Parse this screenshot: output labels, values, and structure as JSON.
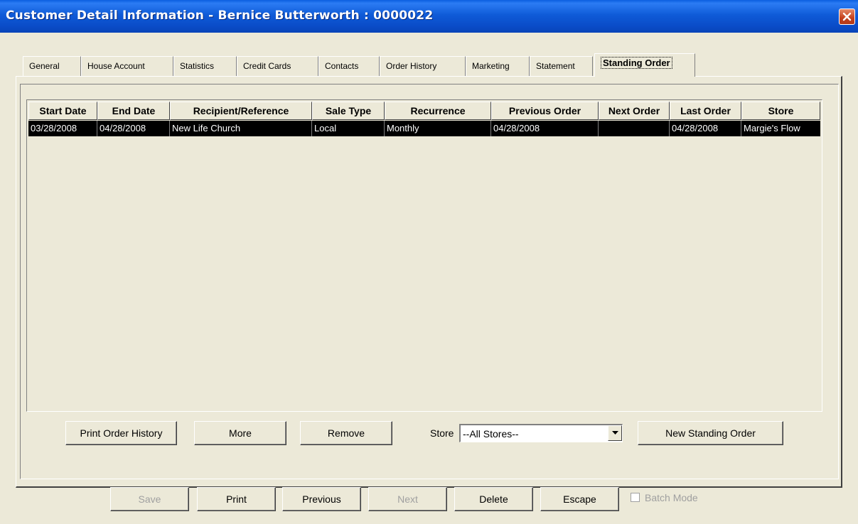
{
  "window": {
    "title": "Customer Detail Information - Bernice Butterworth : 0000022",
    "close_icon": "close-icon"
  },
  "tabs": [
    {
      "label": "General"
    },
    {
      "label": "House Account"
    },
    {
      "label": "Statistics"
    },
    {
      "label": "Credit Cards"
    },
    {
      "label": "Contacts"
    },
    {
      "label": "Order History"
    },
    {
      "label": "Marketing"
    },
    {
      "label": "Statement"
    },
    {
      "label": "Standing Order",
      "active": true
    }
  ],
  "grid": {
    "columns": [
      "Start Date",
      "End Date",
      "Recipient/Reference",
      "Sale Type",
      "Recurrence",
      "Previous Order",
      "Next Order",
      "Last Order",
      "Store"
    ],
    "rows": [
      [
        "03/28/2008",
        "04/28/2008",
        "New Life Church",
        "Local",
        "Monthly",
        "04/28/2008",
        "",
        "04/28/2008",
        "Margie's Flow"
      ]
    ]
  },
  "panel_buttons": {
    "print_history": "Print Order History",
    "more": "More",
    "remove": "Remove",
    "store_label": "Store",
    "store_value": "--All Stores--",
    "new_order": "New Standing Order"
  },
  "footer": {
    "save": "Save",
    "print": "Print",
    "previous": "Previous",
    "next": "Next",
    "delete": "Delete",
    "escape": "Escape",
    "batch_mode": "Batch Mode"
  }
}
